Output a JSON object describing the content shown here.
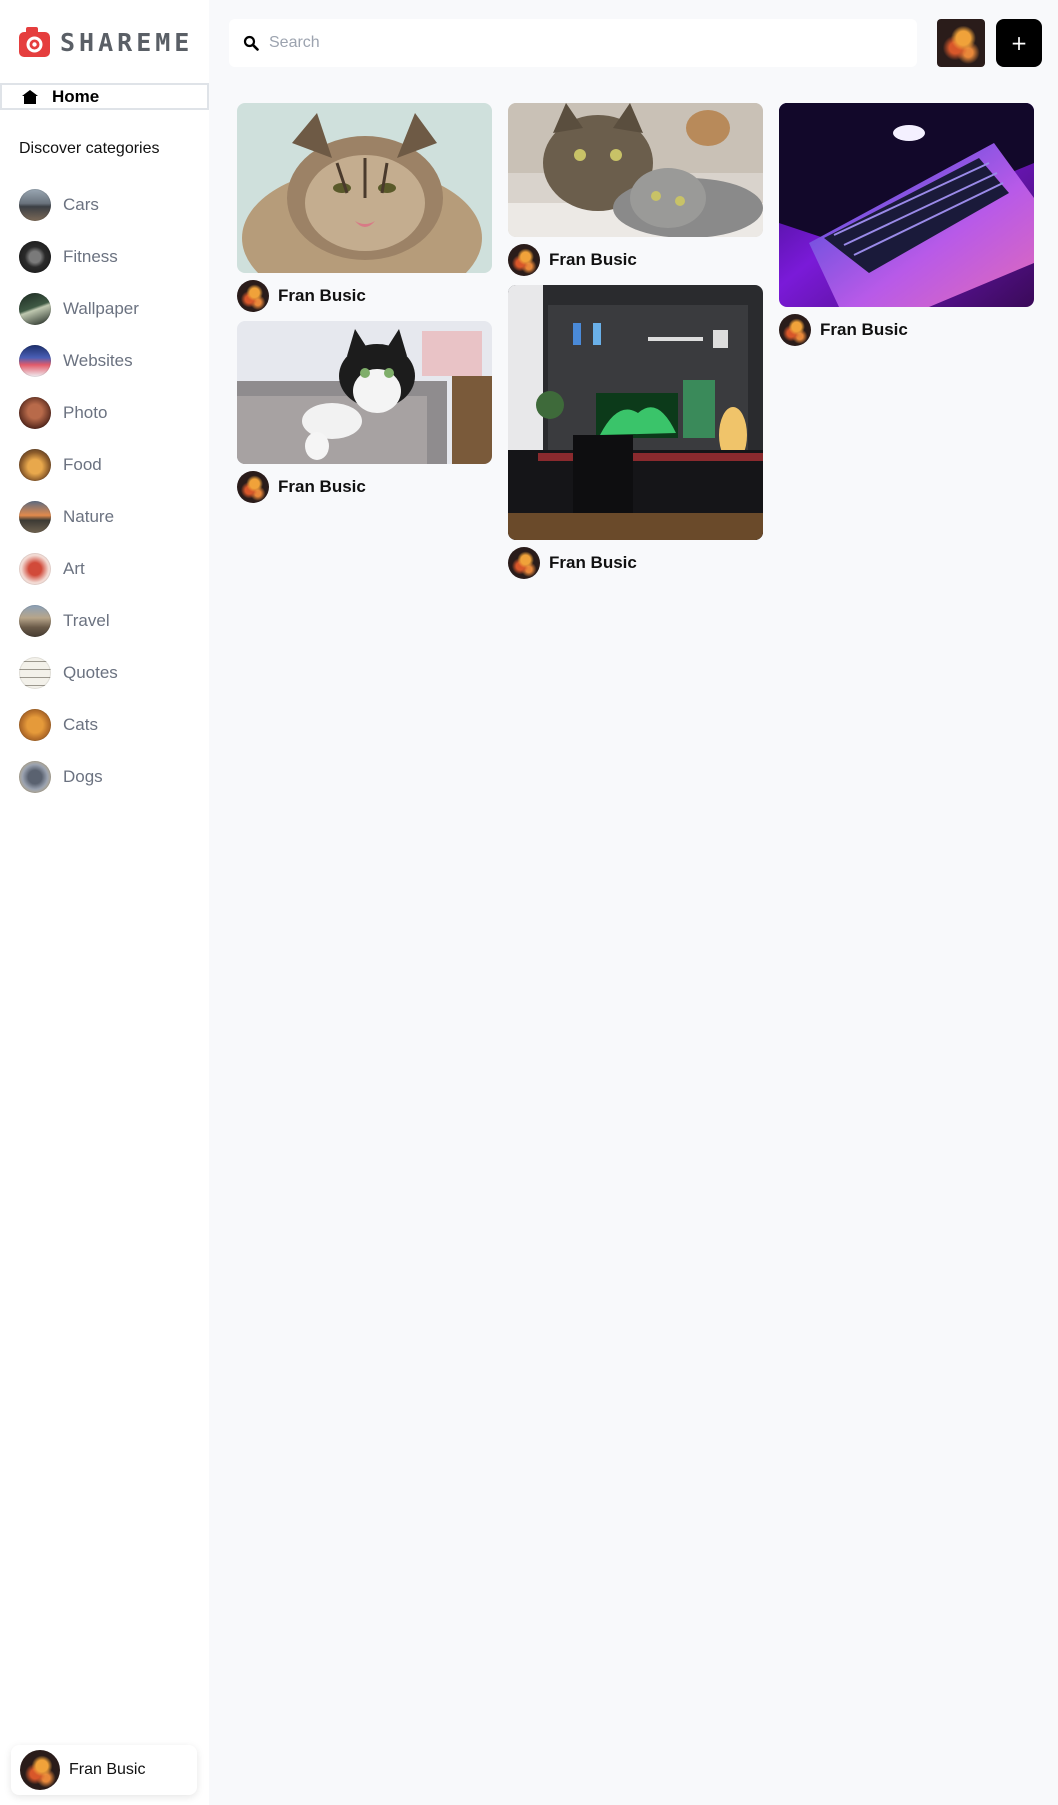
{
  "app": {
    "logo_text": "SHAREME"
  },
  "sidebar": {
    "home_label": "Home",
    "categories_heading": "Discover categories",
    "categories": [
      {
        "label": "Cars",
        "thumb": "linear-gradient(180deg,#9aa7b3 0%,#6a737d 45%,#3b3f44 55%,#7b6a58 100%)"
      },
      {
        "label": "Fitness",
        "thumb": "radial-gradient(circle at 50% 50%,#7a7a7a 0 25%,#2b2b2b 45%,#141414 100%)"
      },
      {
        "label": "Wallpaper",
        "thumb": "linear-gradient(160deg,#1d2a22 0%,#3f5a44 45%,#bfc8b0 52%,#1a241d 100%)"
      },
      {
        "label": "Websites",
        "thumb": "linear-gradient(180deg,#1d2f6b 0%,#4a5fb5 40%,#e25b6a 62%,#f0f0f4 100%)"
      },
      {
        "label": "Photo",
        "thumb": "radial-gradient(circle at 50% 45%,#b86a4a 0 30%,#5a2b1f 70%,#2a140f 100%)"
      },
      {
        "label": "Food",
        "thumb": "radial-gradient(circle at 50% 55%,#e8a84c 0 30%,#8a5a2a 60%,#3a2c24 100%)"
      },
      {
        "label": "Nature",
        "thumb": "linear-gradient(180deg,#5d6b80 0%,#e28a4c 45%,#3c3a34 60%,#6f6250 100%)"
      },
      {
        "label": "Art",
        "thumb": "radial-gradient(circle at 50% 50%,#d14a3a 0 28%,#f2d9d2 60%,#f7f1ef 100%)"
      },
      {
        "label": "Travel",
        "thumb": "linear-gradient(180deg,#8aa0b8 0%,#b7a58a 40%,#6a5a48 70%,#463c32 100%)"
      },
      {
        "label": "Quotes",
        "thumb": "repeating-linear-gradient(180deg,#f3f1ea 0 4px,#9c988e 4px 5px,#f3f1ea 5px 8px)"
      },
      {
        "label": "Cats",
        "thumb": "radial-gradient(circle at 50% 50%,#e59a3a 0 35%,#b8702a 60%,#7a4a1d 100%)"
      },
      {
        "label": "Dogs",
        "thumb": "radial-gradient(circle at 50% 50%,#5a6270 0 30%,#9aa2b0 55%,#d6b36a 100%)"
      }
    ],
    "user_name": "Fran Busic"
  },
  "topbar": {
    "search_placeholder": "Search",
    "add_label": "+"
  },
  "pins": [
    {
      "user": "Fran Busic"
    },
    {
      "user": "Fran Busic"
    },
    {
      "user": "Fran Busic"
    },
    {
      "user": "Fran Busic"
    },
    {
      "user": "Fran Busic"
    }
  ],
  "colors": {
    "logo_red": "#e53e3e",
    "background": "#f8f9fb",
    "add_button": "#000000"
  },
  "icons": [
    "camera-logo-icon",
    "home-icon",
    "search-icon",
    "plus-icon"
  ]
}
